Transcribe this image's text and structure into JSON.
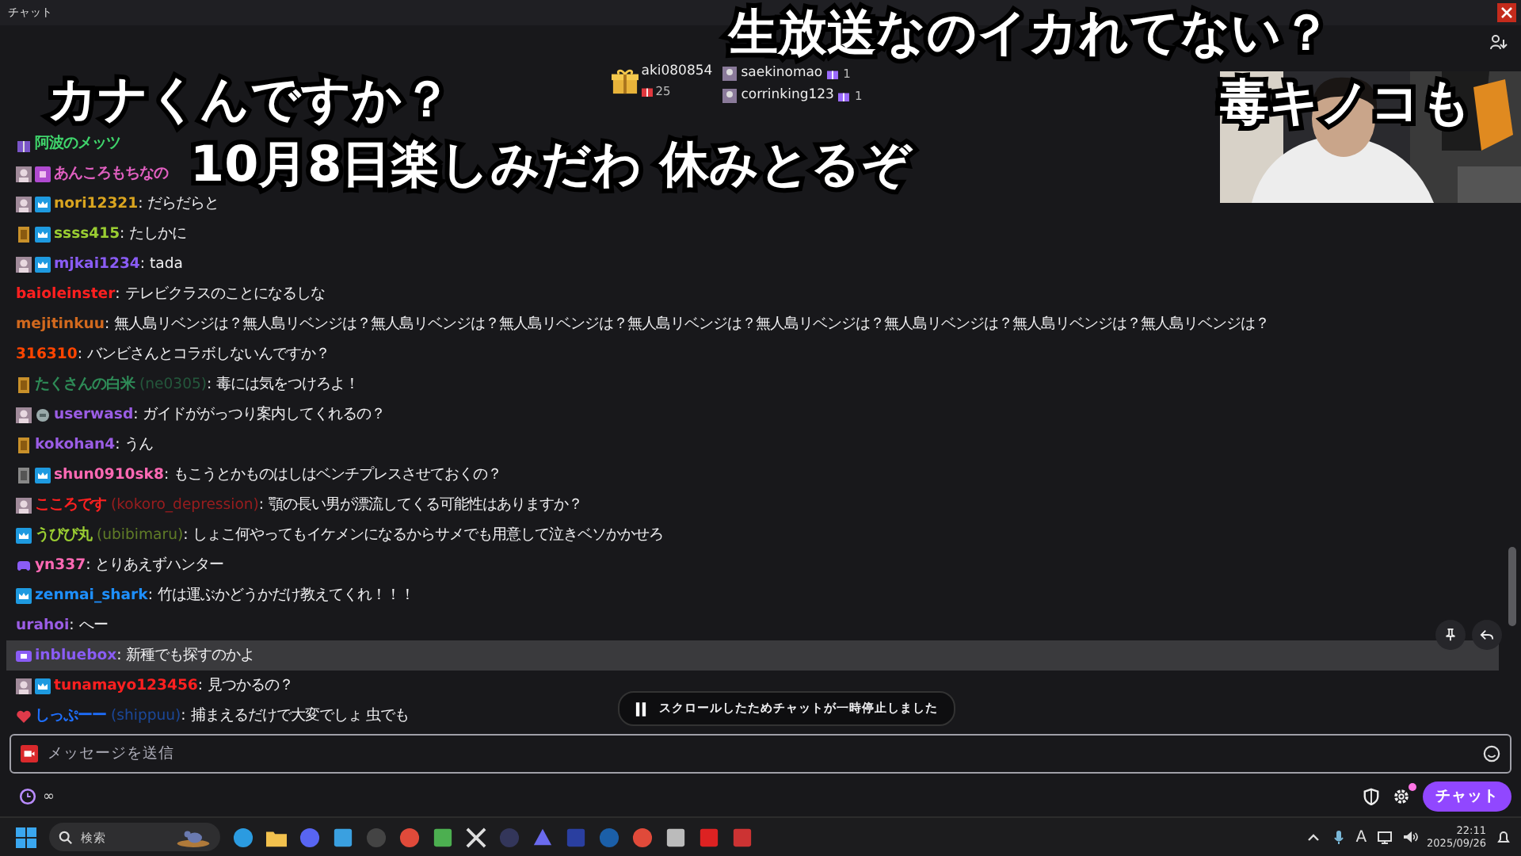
{
  "window": {
    "title": "チャット"
  },
  "captions": [
    "生放送なのイカれてない？",
    "カナくんですか？",
    "毒キノコも",
    "10月8日楽しみだわ 休みとるぞ"
  ],
  "gift_leaderboard": [
    {
      "name": "aki080854",
      "count": "25",
      "kind": "top"
    },
    {
      "name": "saekinomao",
      "count": "1",
      "kind": "runner"
    },
    {
      "name": "corrinking123",
      "count": "1",
      "kind": "runner"
    }
  ],
  "messages": [
    {
      "user": "阿波のメッツ",
      "color": "#3fd46b",
      "badges": [
        {
          "kind": "gift"
        }
      ],
      "hovered": false
    },
    {
      "user": "あんころもちなの",
      "color": "#e05fc0",
      "badges": [
        {
          "kind": "avatar"
        },
        {
          "kind": "sub"
        }
      ],
      "hovered": false
    },
    {
      "user": "nori12321",
      "color": "#daa520",
      "badges": [
        {
          "kind": "avatar"
        },
        {
          "kind": "crown"
        }
      ],
      "message": ": だらだらと",
      "hovered": false
    },
    {
      "user": "ssss415",
      "color": "#9acd32",
      "badges": [
        {
          "kind": "gold"
        },
        {
          "kind": "crown"
        }
      ],
      "message": ": たしかに",
      "hovered": false
    },
    {
      "user": "mjkai1234",
      "color": "#8a5cf5",
      "badges": [
        {
          "kind": "avatar"
        },
        {
          "kind": "crown"
        }
      ],
      "message": ": tada",
      "hovered": false
    },
    {
      "user": "baioleinster",
      "color": "#ff2020",
      "message": ": テレビクラスのことになるしな",
      "hovered": false
    },
    {
      "user": "mejitinkuu",
      "color": "#d2691e",
      "message": ": 無人島リベンジは？無人島リベンジは？無人島リベンジは？無人島リベンジは？無人島リベンジは？無人島リベンジは？無人島リベンジは？無人島リベンジは？無人島リベンジは？",
      "hovered": false
    },
    {
      "user": "316310",
      "color": "#ff4500",
      "message": ": バンビさんとコラボしないんですか？",
      "hovered": false
    },
    {
      "user": "たくさんの白米",
      "color": "#2e8b57",
      "user_id": "(ne0305)",
      "badges": [
        {
          "kind": "gold"
        }
      ],
      "message": ": 毒には気をつけろよ！",
      "hovered": false
    },
    {
      "user": "userwasd",
      "color": "#9b5de5",
      "badges": [
        {
          "kind": "avatar"
        },
        {
          "kind": "gray"
        }
      ],
      "message": ": ガイドががっつり案内してくれるの？",
      "hovered": false
    },
    {
      "user": "kokohan4",
      "color": "#9b5de5",
      "badges": [
        {
          "kind": "gold"
        }
      ],
      "message": ": うん",
      "hovered": false
    },
    {
      "user": "shun0910sk8",
      "color": "#ff69b4",
      "badges": [
        {
          "kind": "silver"
        },
        {
          "kind": "crown"
        }
      ],
      "message": ": もこうとかものはしはベンチプレスさせておくの？",
      "hovered": false
    },
    {
      "user": "こころです",
      "color": "#ff2020",
      "user_id": "(kokoro_depression)",
      "badges": [
        {
          "kind": "avatar"
        }
      ],
      "message": ": 顎の長い男が漂流してくる可能性はありますか？",
      "hovered": false
    },
    {
      "user": "うびび丸",
      "color": "#9acd32",
      "user_id": "(ubibimaru)",
      "badges": [
        {
          "kind": "crown"
        }
      ],
      "message": ": しょこ何やってもイケメンになるからサメでも用意して泣きベソかかせろ",
      "hovered": false
    },
    {
      "user": "yn337",
      "color": "#ff69b4",
      "badges": [
        {
          "kind": "controller"
        }
      ],
      "message": ": とりあえずハンター",
      "hovered": false
    },
    {
      "user": "zenmai_shark",
      "color": "#1e90ff",
      "badges": [
        {
          "kind": "crown"
        }
      ],
      "message": ": 竹は運ぶかどうかだけ教えてくれ！！！",
      "hovered": false
    },
    {
      "user": "urahoi",
      "color": "#9b5de5",
      "message": ": へー",
      "hovered": false
    },
    {
      "user": "inbluebox",
      "color": "#8a5cf5",
      "badges": [
        {
          "kind": "video"
        }
      ],
      "message": ": 新種でも探すのかよ",
      "hovered": true
    },
    {
      "user": "tunamayo123456",
      "color": "#ff2020",
      "badges": [
        {
          "kind": "avatar"
        },
        {
          "kind": "crown"
        }
      ],
      "message": ": 見つかるの？",
      "hovered": false
    },
    {
      "user": "しっぷーー",
      "color": "#1e6fff",
      "user_id": "(shippuu)",
      "badges": [
        {
          "kind": "heart"
        }
      ],
      "message": ": 捕まえるだけで大変でしょ 虫でも",
      "hovered": false
    }
  ],
  "pause_banner": "スクロールしたためチャットが一時停止しました",
  "input": {
    "placeholder": "メッセージを送信"
  },
  "timer": "∞",
  "settings_notification": true,
  "send_button": "チャット",
  "taskbar": {
    "search": {
      "placeholder": "検索"
    },
    "language": "A",
    "time": "22:11",
    "date": "2025/09/26"
  }
}
